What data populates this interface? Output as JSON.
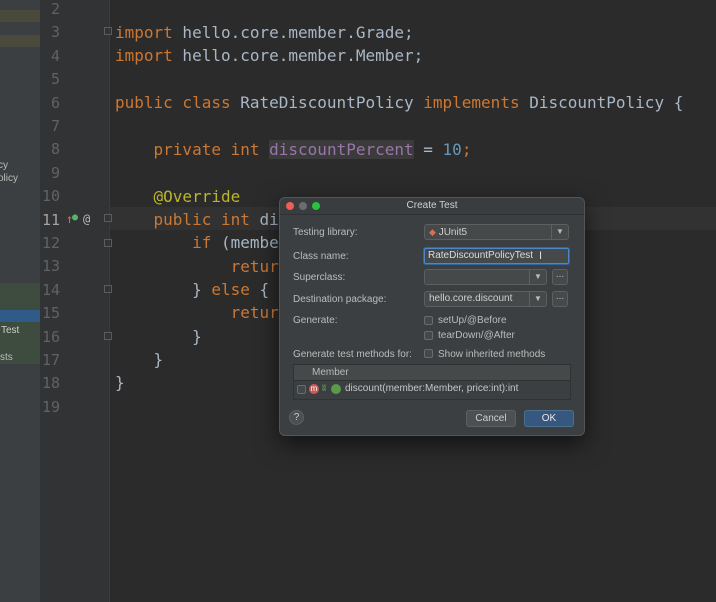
{
  "project_panel": {
    "items": [
      "cy",
      "olicy",
      "Test",
      "sts"
    ]
  },
  "editor": {
    "line_numbers": [
      "2",
      "3",
      "4",
      "5",
      "6",
      "7",
      "8",
      "9",
      "10",
      "11",
      "12",
      "13",
      "14",
      "15",
      "16",
      "17",
      "18",
      "19"
    ],
    "line3": {
      "kw": "import",
      "rest": " hello.core.member.Grade;"
    },
    "line4": {
      "kw": "import",
      "rest": " hello.core.member.Member;"
    },
    "line6": {
      "kw1": "public class",
      "name": " RateDiscountPolicy ",
      "kw2": "implements",
      "rest": " DiscountPolicy {"
    },
    "line8": {
      "kw": "private int",
      "field": "discountPercent",
      "eq": " = ",
      "num": "10",
      "end": ";"
    },
    "line10": {
      "anno": "@Override"
    },
    "line11": {
      "kw": "public int",
      "rest": " disc"
    },
    "line12": {
      "kw": "if",
      "rest": " (member"
    },
    "line13": {
      "kw": "return"
    },
    "line14": {
      "a": "} ",
      "kw": "else",
      "b": " {"
    },
    "line15": {
      "kw": "return"
    },
    "line16": {
      "t": "}"
    },
    "line17": {
      "t": "}"
    },
    "line18": {
      "t": "}"
    },
    "gutter_icons": {
      "override": "↑",
      "at": "@"
    }
  },
  "dialog": {
    "title": "Create Test",
    "labels": {
      "testing_library": "Testing library:",
      "class_name": "Class name:",
      "superclass": "Superclass:",
      "destination": "Destination package:",
      "generate": "Generate:",
      "methods_for": "Generate test methods for:"
    },
    "testing_library_value": "JUnit5",
    "class_name_value": "RateDiscountPolicyTest",
    "superclass_value": "",
    "destination_value": "hello.core.discount",
    "browse": "...",
    "setup": "setUp/@Before",
    "teardown": "tearDown/@After",
    "show_inherited": "Show inherited methods",
    "table_header": "Member",
    "method": "discount(member:Member, price:int):int",
    "method_icon": "m",
    "cancel": "Cancel",
    "ok": "OK",
    "help": "?"
  },
  "colors": {
    "accent_ok": "#365880",
    "keyword": "#cc7832",
    "field": "#9876aa",
    "number": "#6897bb",
    "annotation": "#bbb529"
  }
}
